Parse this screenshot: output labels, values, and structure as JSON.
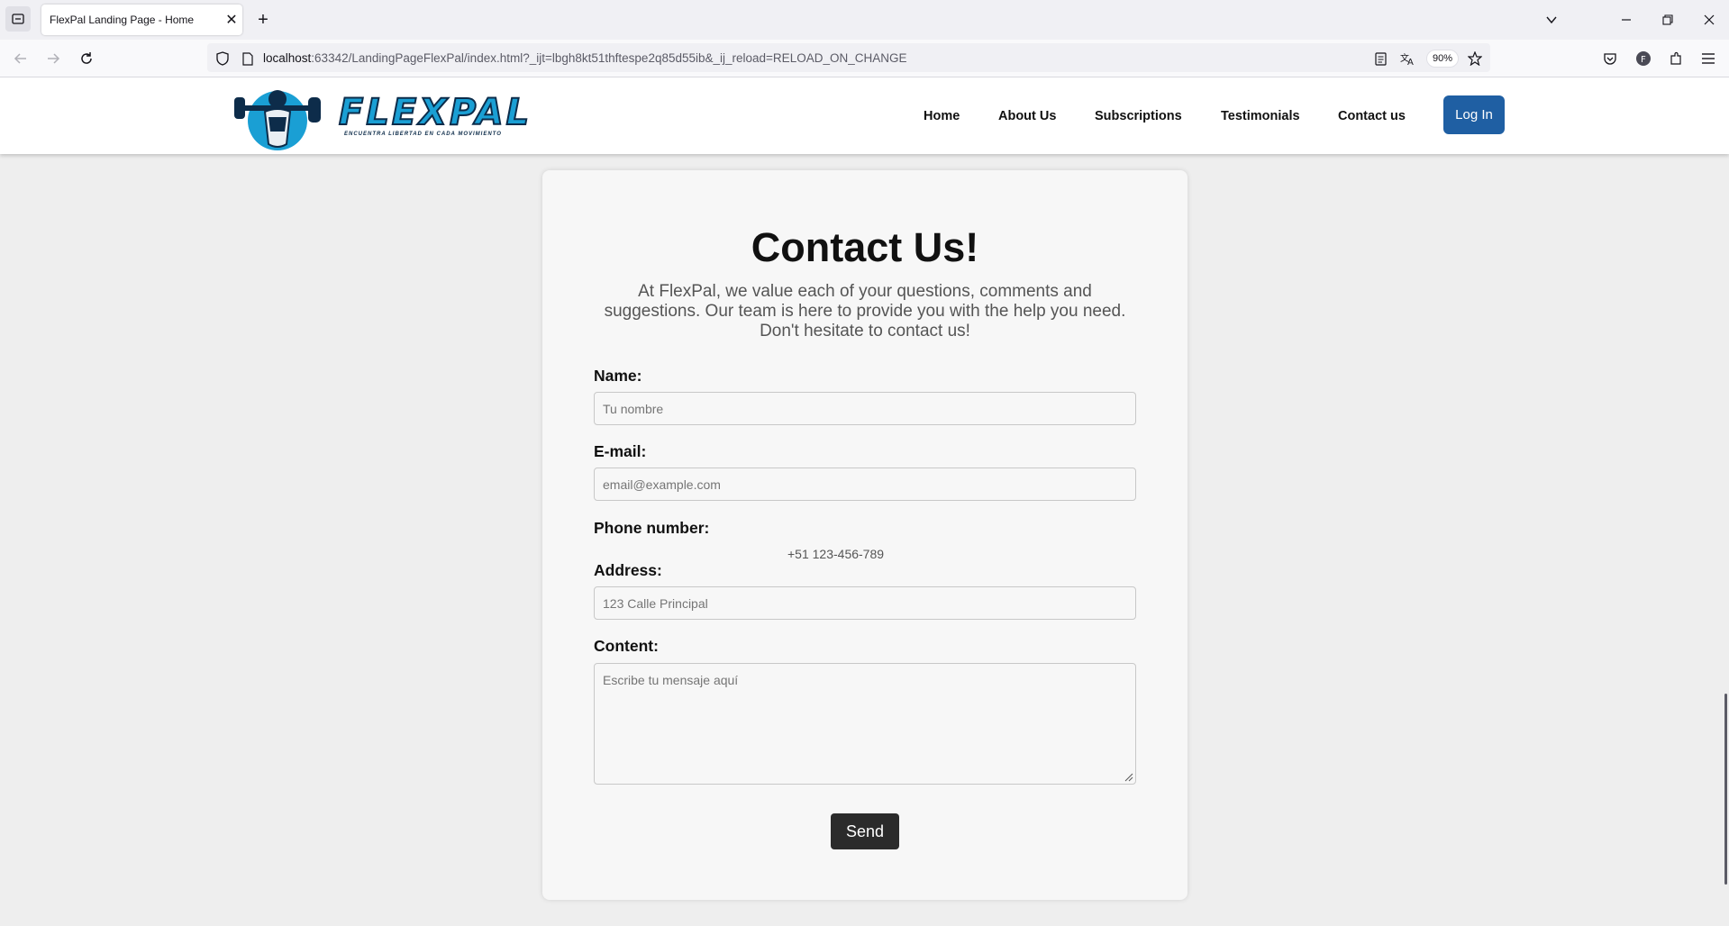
{
  "browser": {
    "tab_title": "FlexPal Landing Page - Home",
    "url_host": "localhost",
    "url_rest": ":63342/LandingPageFlexPal/index.html?_ijt=lbgh8kt51thftespe2q85d55ib&_ij_reload=RELOAD_ON_CHANGE",
    "zoom": "90%"
  },
  "site": {
    "logo_text": "FLEXPAL",
    "logo_tagline": "ENCUENTRA LIBERTAD EN CADA MOVIMIENTO",
    "nav": {
      "home": "Home",
      "about": "About Us",
      "subscriptions": "Subscriptions",
      "testimonials": "Testimonials",
      "contact": "Contact us"
    },
    "login_label": "Log In"
  },
  "contact": {
    "title": "Contact Us!",
    "intro": "At FlexPal, we value each of your questions, comments and suggestions. Our team is here to provide you with the help you need. Don't hesitate to contact us!",
    "name_label": "Name:",
    "name_placeholder": "Tu nombre",
    "email_label": "E-mail:",
    "email_placeholder": "email@example.com",
    "phone_label": "Phone number:",
    "phone_value": "+51 123-456-789",
    "address_label": "Address:",
    "address_placeholder": "123 Calle Principal",
    "content_label": "Content:",
    "content_placeholder": "Escribe tu mensaje aquí",
    "send_label": "Send"
  },
  "colors": {
    "login_bg": "#1f5fa3",
    "send_bg": "#2b2b2b",
    "logo_blue": "#1a9fd4"
  }
}
